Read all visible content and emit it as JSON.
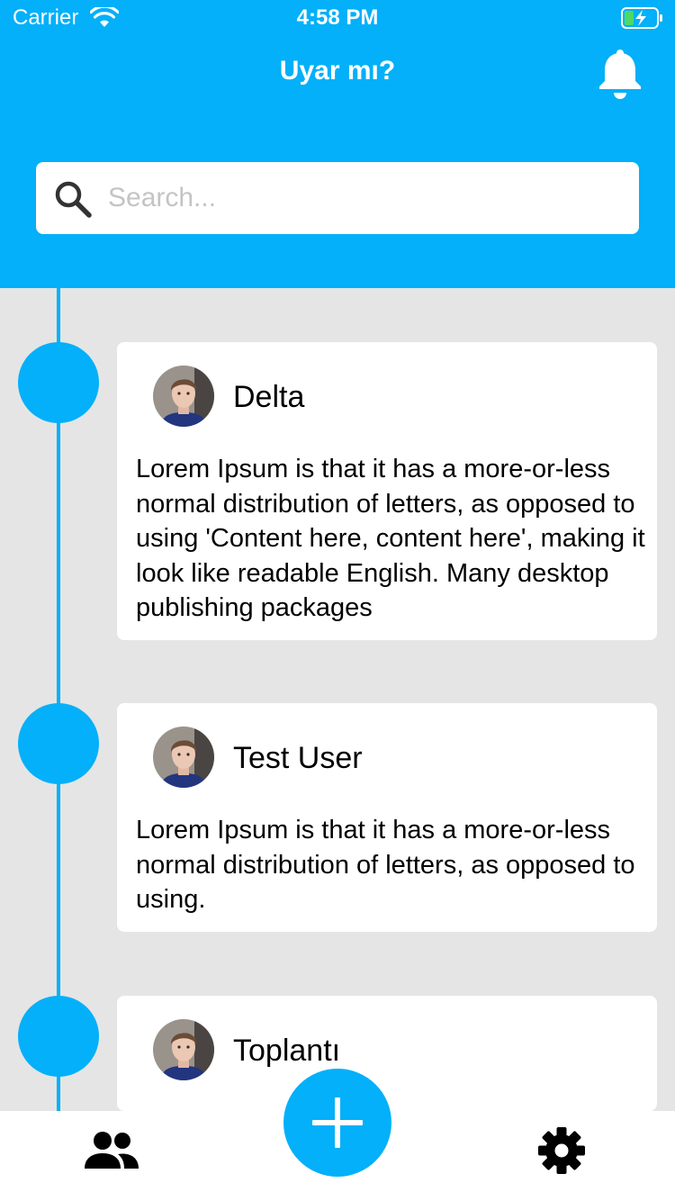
{
  "status_bar": {
    "carrier": "Carrier",
    "time": "4:58 PM"
  },
  "header": {
    "title": "Uyar mı?"
  },
  "search": {
    "placeholder": "Search..."
  },
  "posts": [
    {
      "name": "Delta",
      "text": "Lorem Ipsum is that it has a more-or-less normal distribution of letters, as opposed to using 'Content here, content here', making it look like readable English. Many desktop publishing packages"
    },
    {
      "name": "Test User",
      "text": "Lorem Ipsum is that it has a more-or-less normal distribution of letters, as opposed to using."
    },
    {
      "name": "Toplantı",
      "text": ""
    }
  ],
  "colors": {
    "accent": "#03b0f9",
    "background": "#e5e5e5",
    "card": "#ffffff"
  },
  "icons": {
    "header_right": "bell-icon",
    "tab_left": "people-icon",
    "tab_center": "plus-icon",
    "tab_right": "gear-icon"
  }
}
